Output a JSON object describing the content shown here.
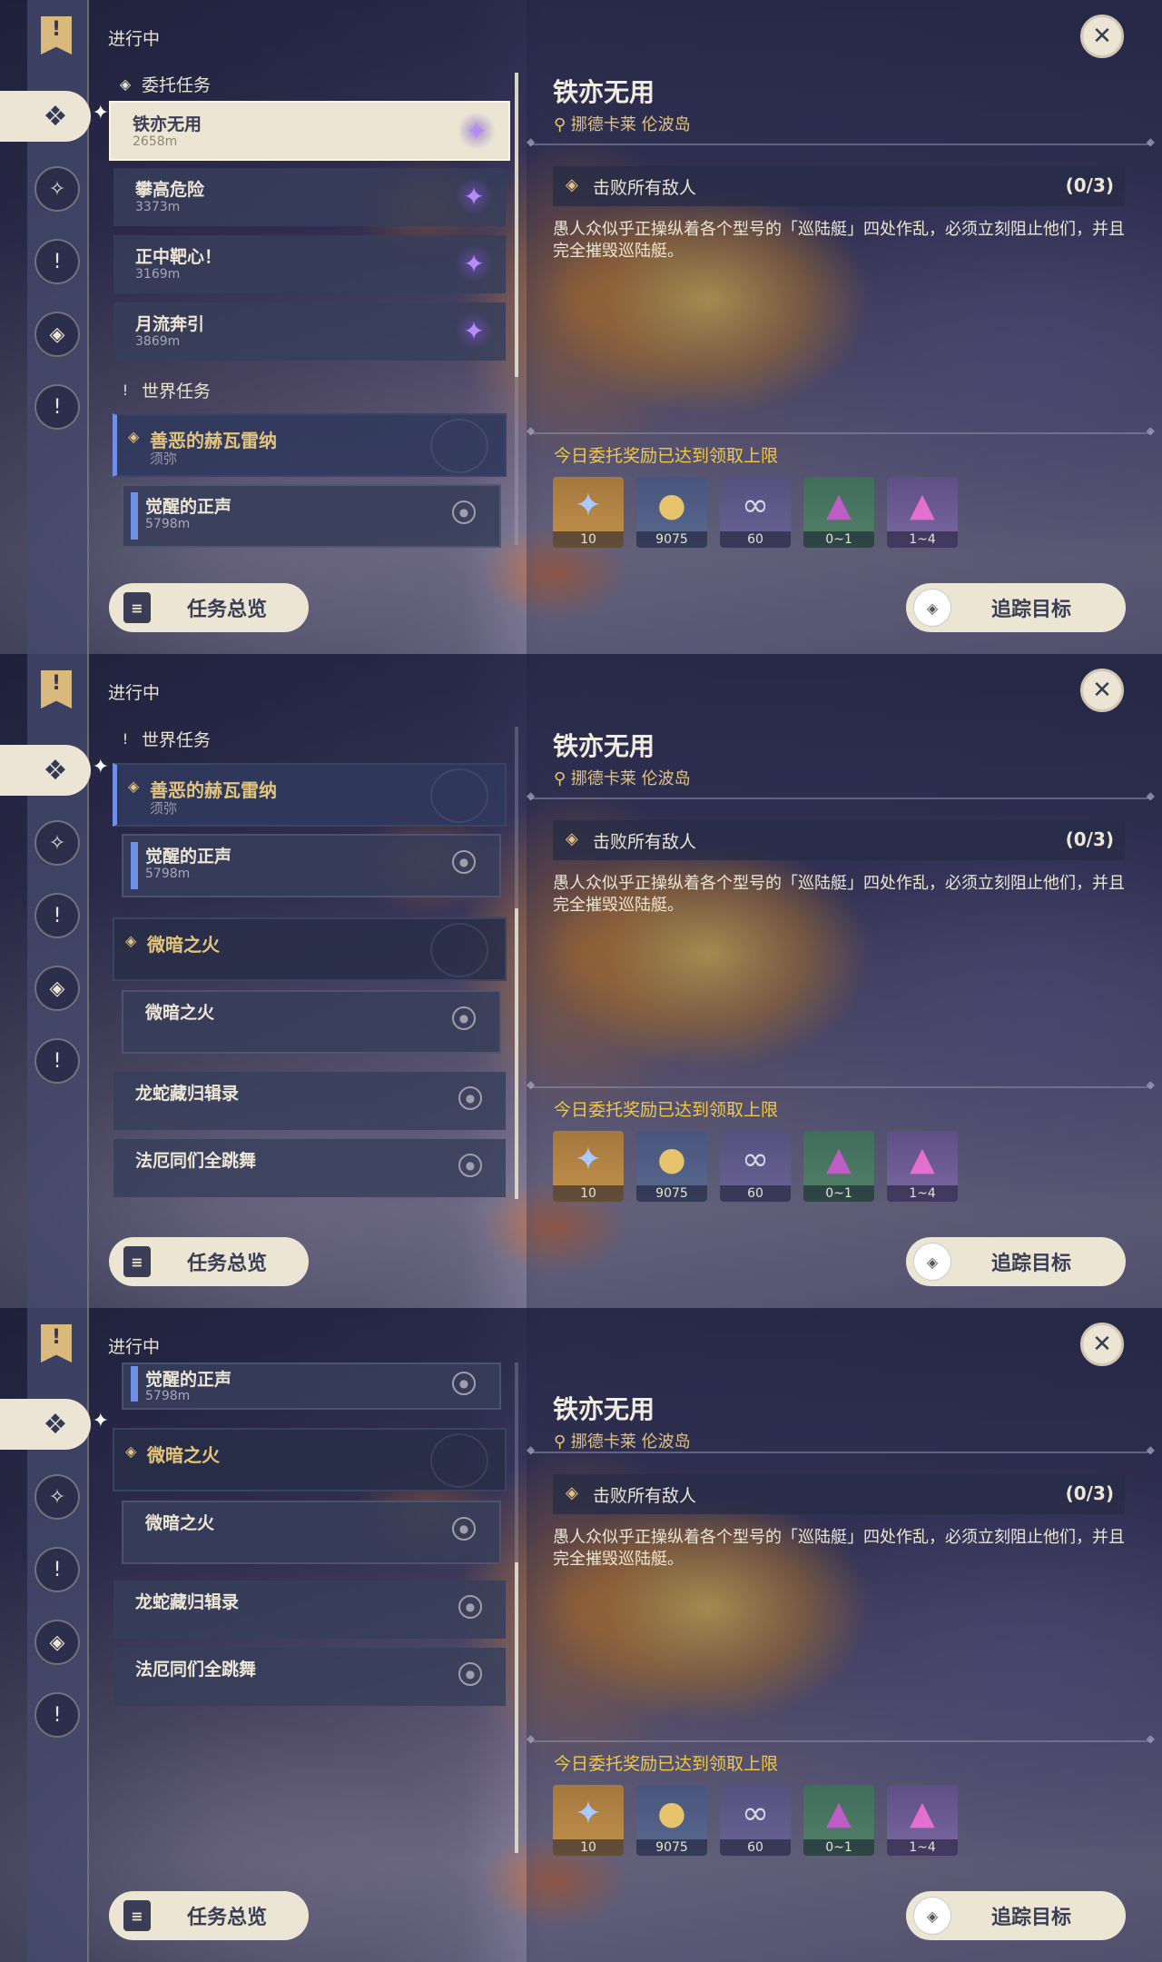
{
  "status_label": "进行中",
  "sections": {
    "commission": "委托任务",
    "world": "世界任务"
  },
  "commissions": [
    {
      "title": "铁亦无用",
      "distance": "2658m"
    },
    {
      "title": "攀高危险",
      "distance": "3373m"
    },
    {
      "title": "正中靶心！",
      "distance": "3169m"
    },
    {
      "title": "月流奔引",
      "distance": "3869m"
    }
  ],
  "world_quests": [
    {
      "title": "善恶的赫瓦雷纳",
      "region": "须弥"
    },
    {
      "title": "微暗之火"
    }
  ],
  "world_subquests": [
    {
      "title": "觉醒的正声",
      "distance": "5798m"
    },
    {
      "title": "微暗之火"
    }
  ],
  "other_quests": [
    {
      "title": "龙蛇藏归辑录"
    },
    {
      "title": "法厄同们全跳舞"
    }
  ],
  "detail": {
    "title": "铁亦无用",
    "location": "挪德卡莱 伦波岛",
    "objective": "击败所有敌人",
    "progress": "(0/3)",
    "description": "愚人众似乎正操纵着各个型号的「巡陆艇」四处作乱，必须立刻阻止他们，并且完全摧毁巡陆艇。",
    "reward_notice": "今日委托奖励已达到领取上限",
    "rewards": [
      {
        "icon": "adventure-exp-icon",
        "count": "10"
      },
      {
        "icon": "mora-coin-icon",
        "count": "9075"
      },
      {
        "icon": "friendship-exp-icon",
        "count": "60"
      },
      {
        "icon": "green-crystal-icon",
        "count": "0~1"
      },
      {
        "icon": "purple-crystal-icon",
        "count": "1~4"
      }
    ]
  },
  "buttons": {
    "overview": "任务总览",
    "track": "追踪目标"
  },
  "colors": {
    "accent_gold": "#e2c47f",
    "notice_yellow": "#f0c94a",
    "selected_bg": "#ece5d3",
    "quest_blue": "#6e90e6"
  }
}
